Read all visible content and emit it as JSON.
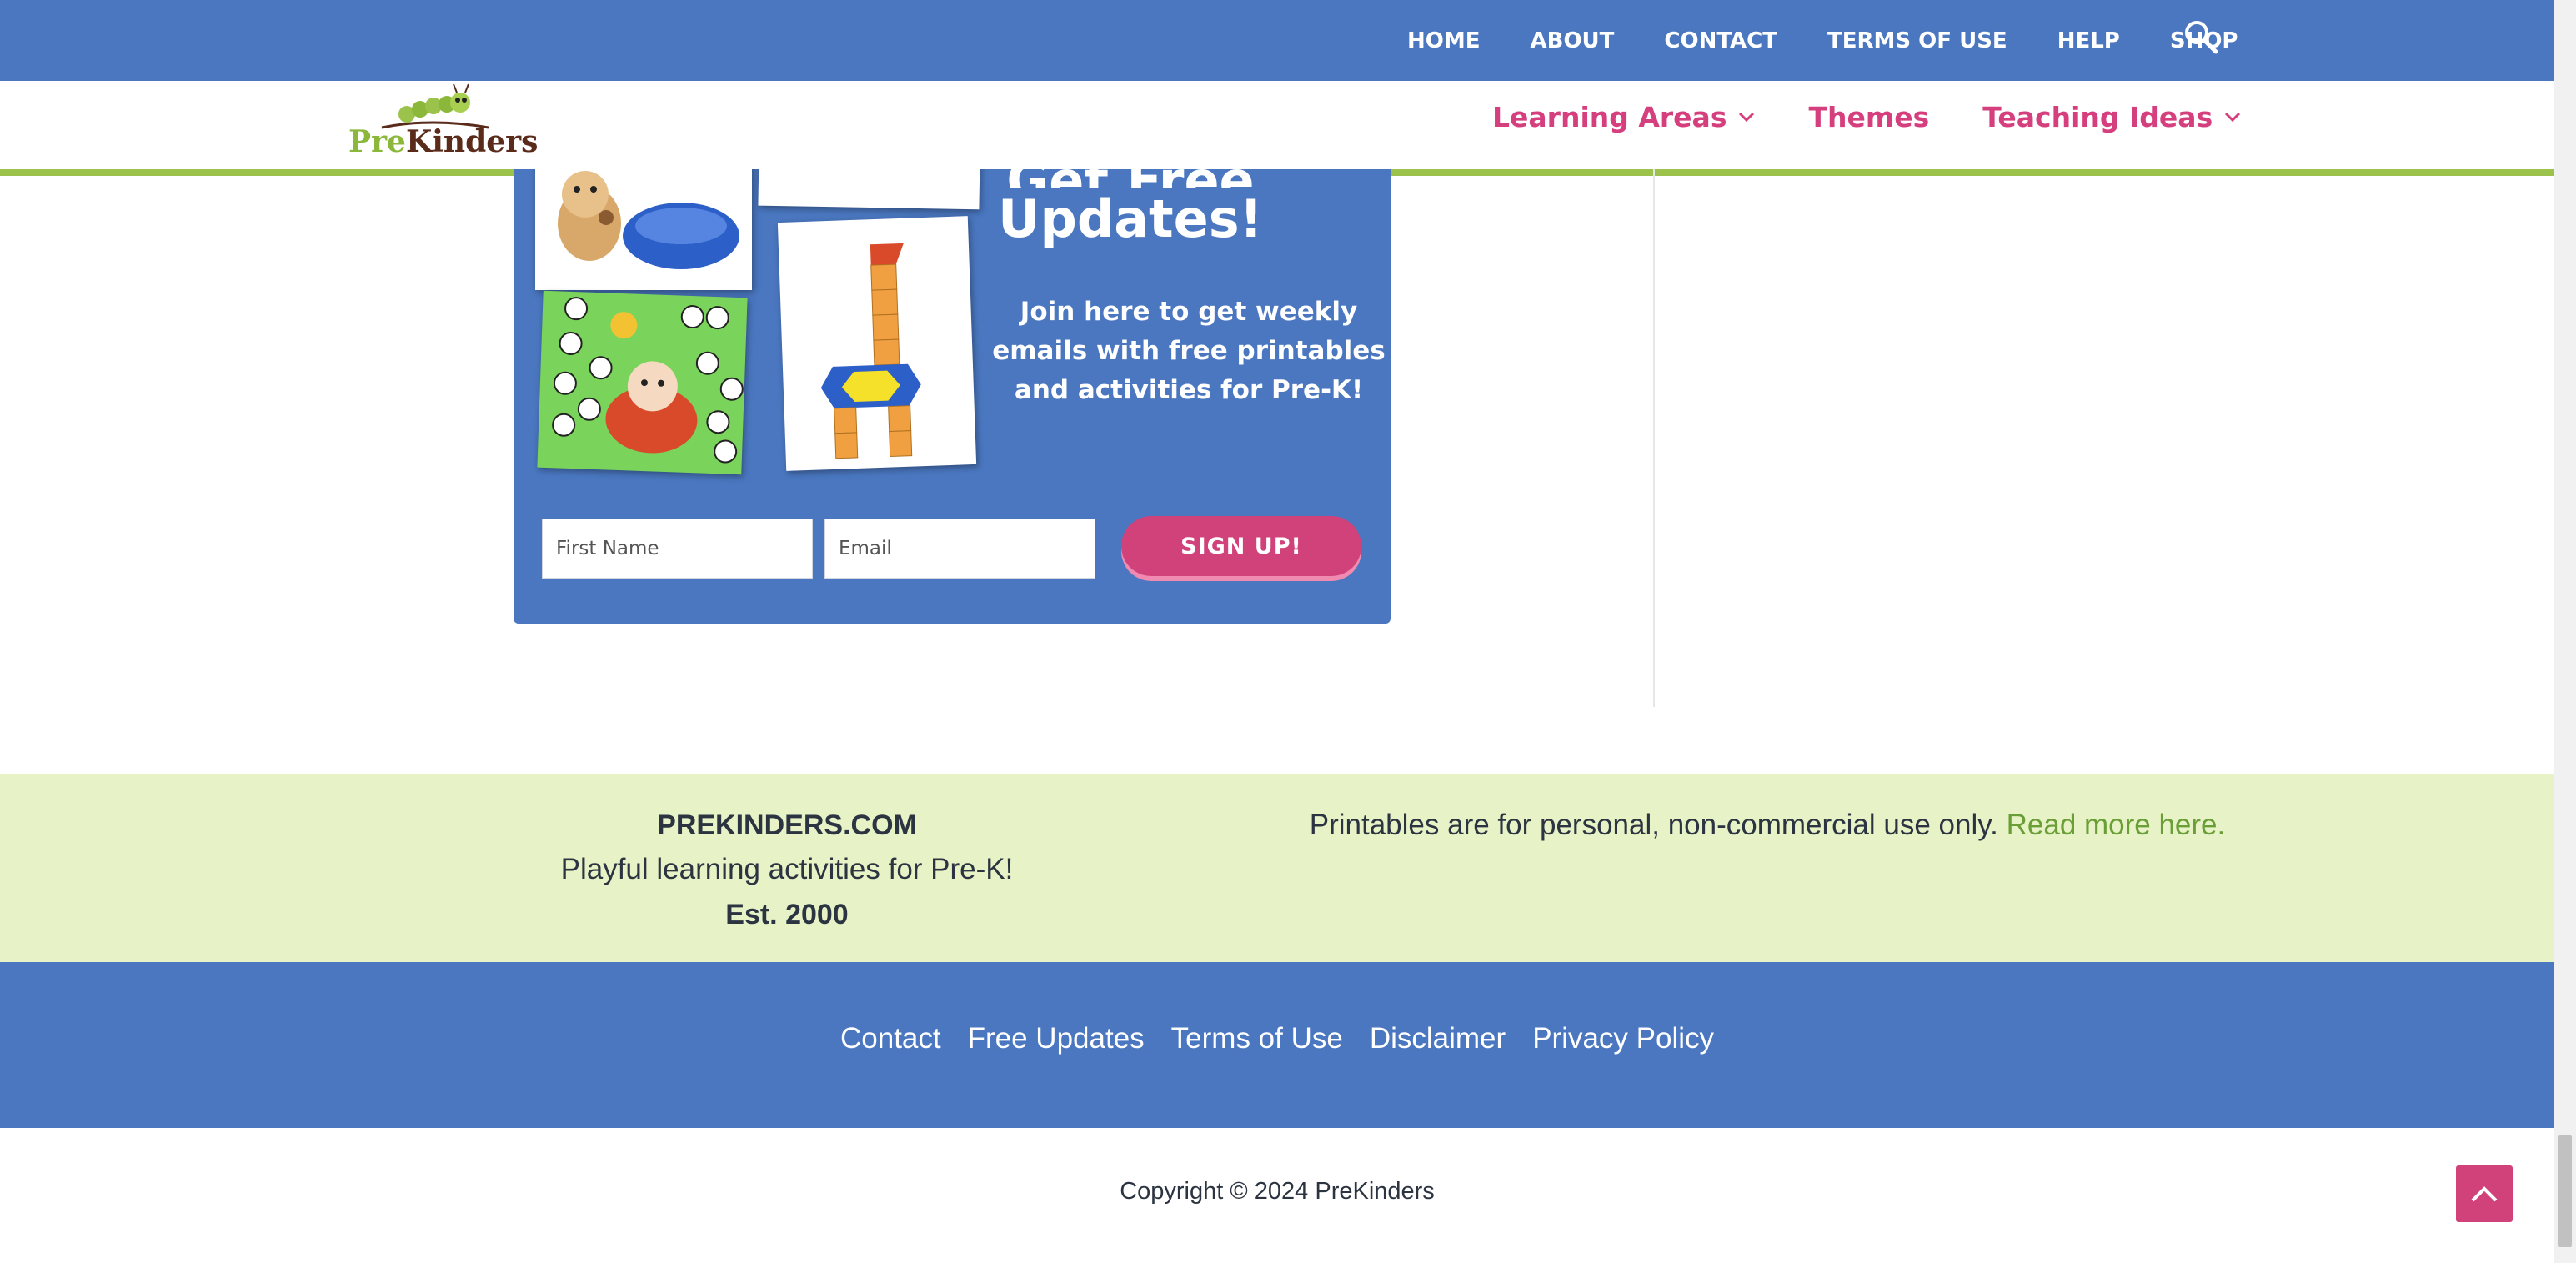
{
  "top_menu": {
    "items": [
      "HOME",
      "ABOUT",
      "CONTACT",
      "TERMS OF USE",
      "HELP",
      "SHOP"
    ],
    "search_icon": "search-icon"
  },
  "header": {
    "logo_pre": "Pre",
    "logo_kinders": "Kinders",
    "nav": [
      {
        "label": "Learning Areas",
        "has_dropdown": true
      },
      {
        "label": "Themes",
        "has_dropdown": false
      },
      {
        "label": "Teaching Ideas",
        "has_dropdown": true
      }
    ]
  },
  "promo": {
    "heading_line1": "Get Free",
    "heading_line2": "Updates!",
    "blurb": "Join here to get weekly emails with free printables and activities for Pre-K!",
    "first_name_placeholder": "First Name",
    "email_placeholder": "Email",
    "signup_label": "SIGN UP!"
  },
  "footer_band": {
    "site_name": "PREKINDERS.COM",
    "tagline": "Playful learning activities for Pre-K!",
    "established": "Est. 2000",
    "disclaimer_text": "Printables are for personal, non-commercial use only.",
    "disclaimer_link": "Read more here."
  },
  "footer_links": [
    "Contact",
    "Free Updates",
    "Terms of Use",
    "Disclaimer",
    "Privacy Policy"
  ],
  "copyright": "Copyright © 2024 PreKinders",
  "colors": {
    "blue": "#4a77c0",
    "pink": "#d1427a",
    "green_band": "#e7f2c6",
    "green_accent": "#9bc24a"
  }
}
